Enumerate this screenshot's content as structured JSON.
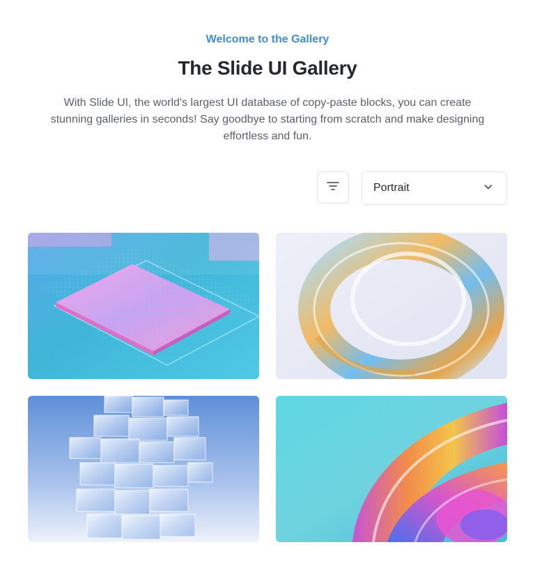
{
  "header": {
    "eyebrow": "Welcome to the Gallery",
    "title": "The Slide UI Gallery",
    "subtitle": "With Slide UI, the world's largest UI database of copy-paste blocks, you can create stunning galleries in seconds! Say goodbye to starting from scratch and make designing effortless and fun."
  },
  "controls": {
    "filter_icon": "filter-lines-icon",
    "orientation_select": {
      "selected": "Portrait",
      "icon": "chevron-down-icon"
    }
  },
  "gallery": {
    "images": [
      {
        "subject": "holographic circuit chip"
      },
      {
        "subject": "iridescent glass torus"
      },
      {
        "subject": "stacked glass cubes tower"
      },
      {
        "subject": "rainbow liquid glass swirl"
      }
    ]
  },
  "colors": {
    "accent": "#3b8fe0",
    "title": "#25282c",
    "body_text": "#5b6168",
    "border": "#dfe2e6"
  }
}
